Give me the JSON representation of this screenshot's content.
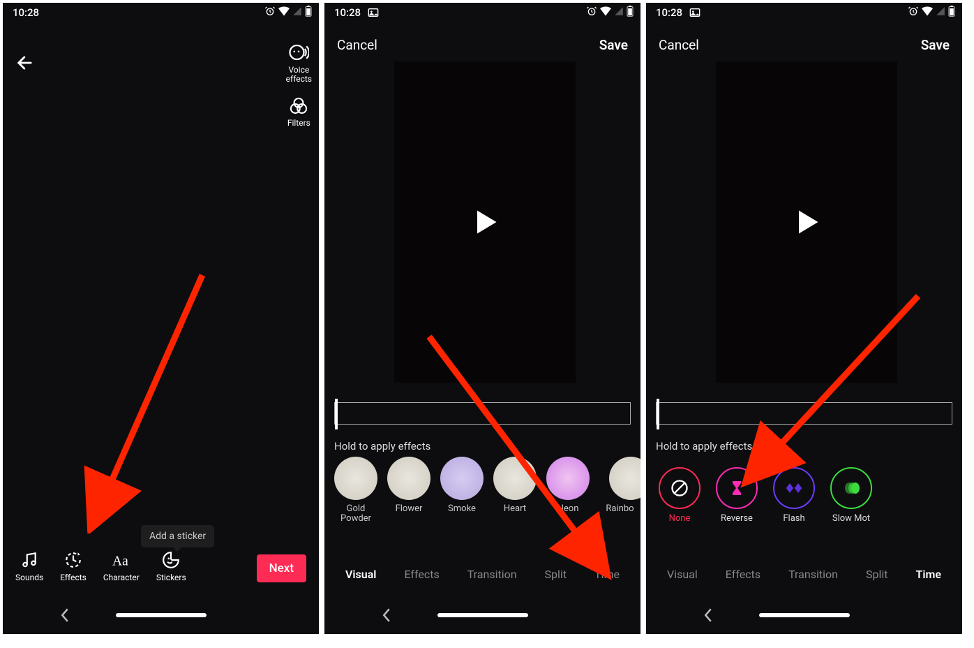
{
  "status": {
    "time": "10:28"
  },
  "frame1": {
    "sidetools": {
      "voice": "Voice\neffects",
      "filters": "Filters"
    },
    "tooltip": "Add a sticker",
    "bottom": {
      "sounds": "Sounds",
      "effects": "Effects",
      "character": "Character",
      "stickers": "Stickers",
      "next": "Next"
    }
  },
  "frame2": {
    "hdr": {
      "cancel": "Cancel",
      "save": "Save"
    },
    "hint": "Hold to apply effects",
    "fx": [
      {
        "label": "Gold\nPowder"
      },
      {
        "label": "Flower"
      },
      {
        "label": "Smoke"
      },
      {
        "label": "Heart"
      },
      {
        "label": "Neon"
      },
      {
        "label": "Rainbo"
      }
    ],
    "tabs": {
      "visual": "Visual",
      "effects": "Effects",
      "transition": "Transition",
      "split": "Split",
      "time": "Time"
    }
  },
  "frame3": {
    "hdr": {
      "cancel": "Cancel",
      "save": "Save"
    },
    "hint": "Hold to apply effects",
    "tfx": {
      "none": "None",
      "reverse": "Reverse",
      "flash": "Flash",
      "slow": "Slow Mot"
    },
    "tabs": {
      "visual": "Visual",
      "effects": "Effects",
      "transition": "Transition",
      "split": "Split",
      "time": "Time"
    }
  }
}
